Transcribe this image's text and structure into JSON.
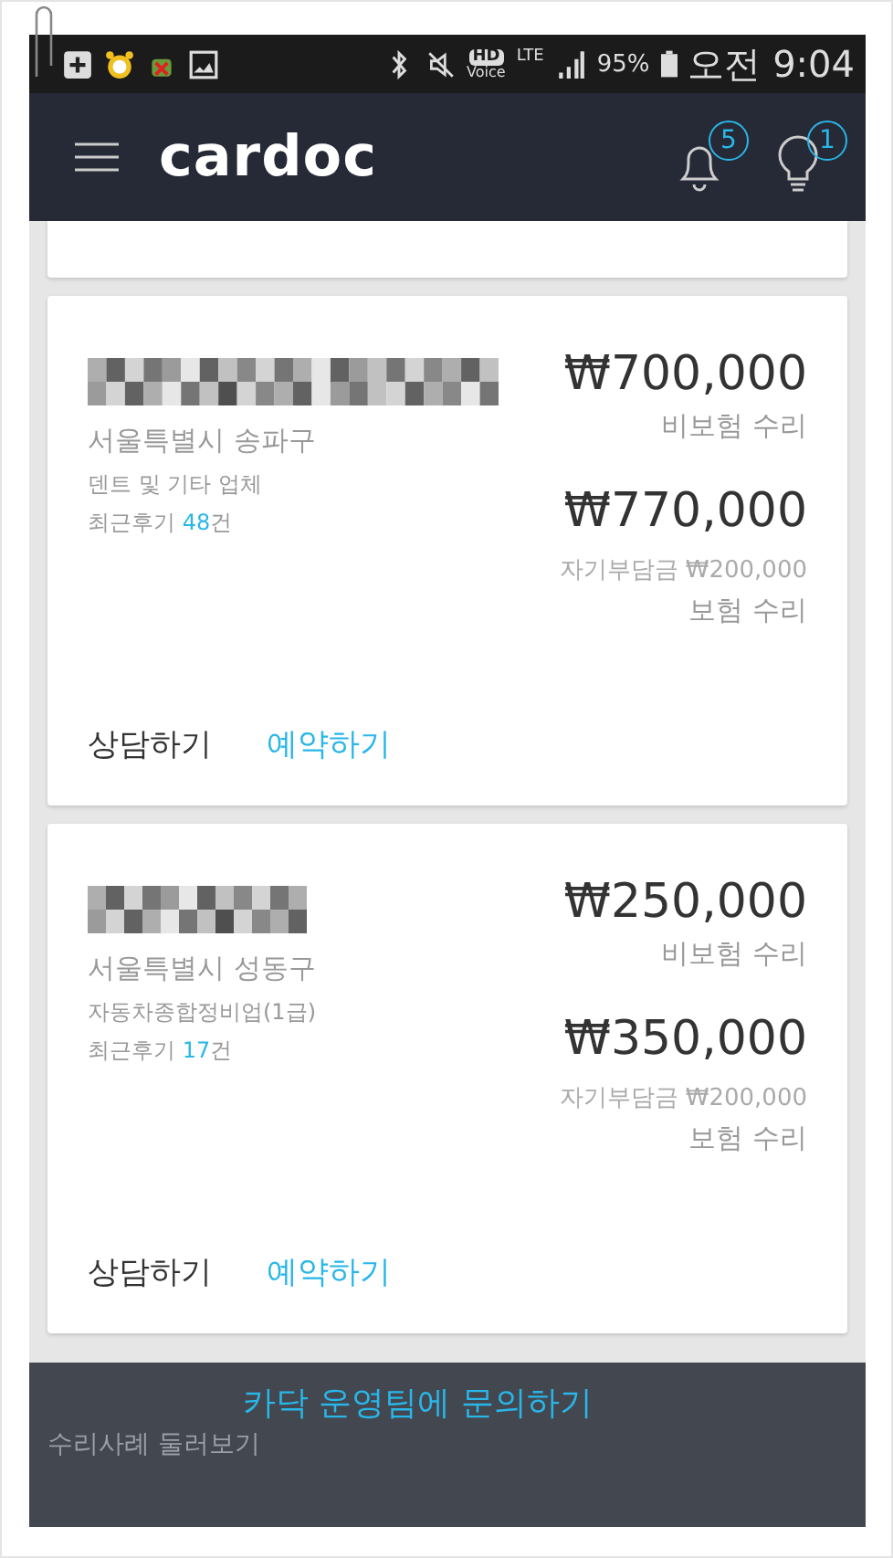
{
  "status_bar": {
    "hd_label": "HD",
    "hd_sub": "Voice",
    "network": "LTE",
    "battery": "95%",
    "time": "오전 9:04"
  },
  "header": {
    "logo": "cardoc",
    "badges": [
      {
        "kind": "bell",
        "count": "5"
      },
      {
        "kind": "bulb",
        "count": "1"
      }
    ]
  },
  "shops": [
    {
      "district": "서울특별시 송파구",
      "category": "덴트 및 기타 업체",
      "reviews_label": "최근후기",
      "reviews_count": "48",
      "reviews_unit": "건",
      "uninsured_price": "₩700,000",
      "uninsured_label": "비보험 수리",
      "insured_price": "₩770,000",
      "deductible": "자기부담금 ₩200,000",
      "insured_label": "보험 수리",
      "consult": "상담하기",
      "reserve": "예약하기"
    },
    {
      "district": "서울특별시 성동구",
      "category": "자동차종합정비업(1급)",
      "reviews_label": "최근후기",
      "reviews_count": "17",
      "reviews_unit": "건",
      "uninsured_price": "₩250,000",
      "uninsured_label": "비보험 수리",
      "insured_price": "₩350,000",
      "deductible": "자기부담금 ₩200,000",
      "insured_label": "보험 수리",
      "consult": "상담하기",
      "reserve": "예약하기"
    }
  ],
  "footer": {
    "contact": "카닥 운영팀에 문의하기",
    "behind": "수리사례 둘러보기"
  }
}
